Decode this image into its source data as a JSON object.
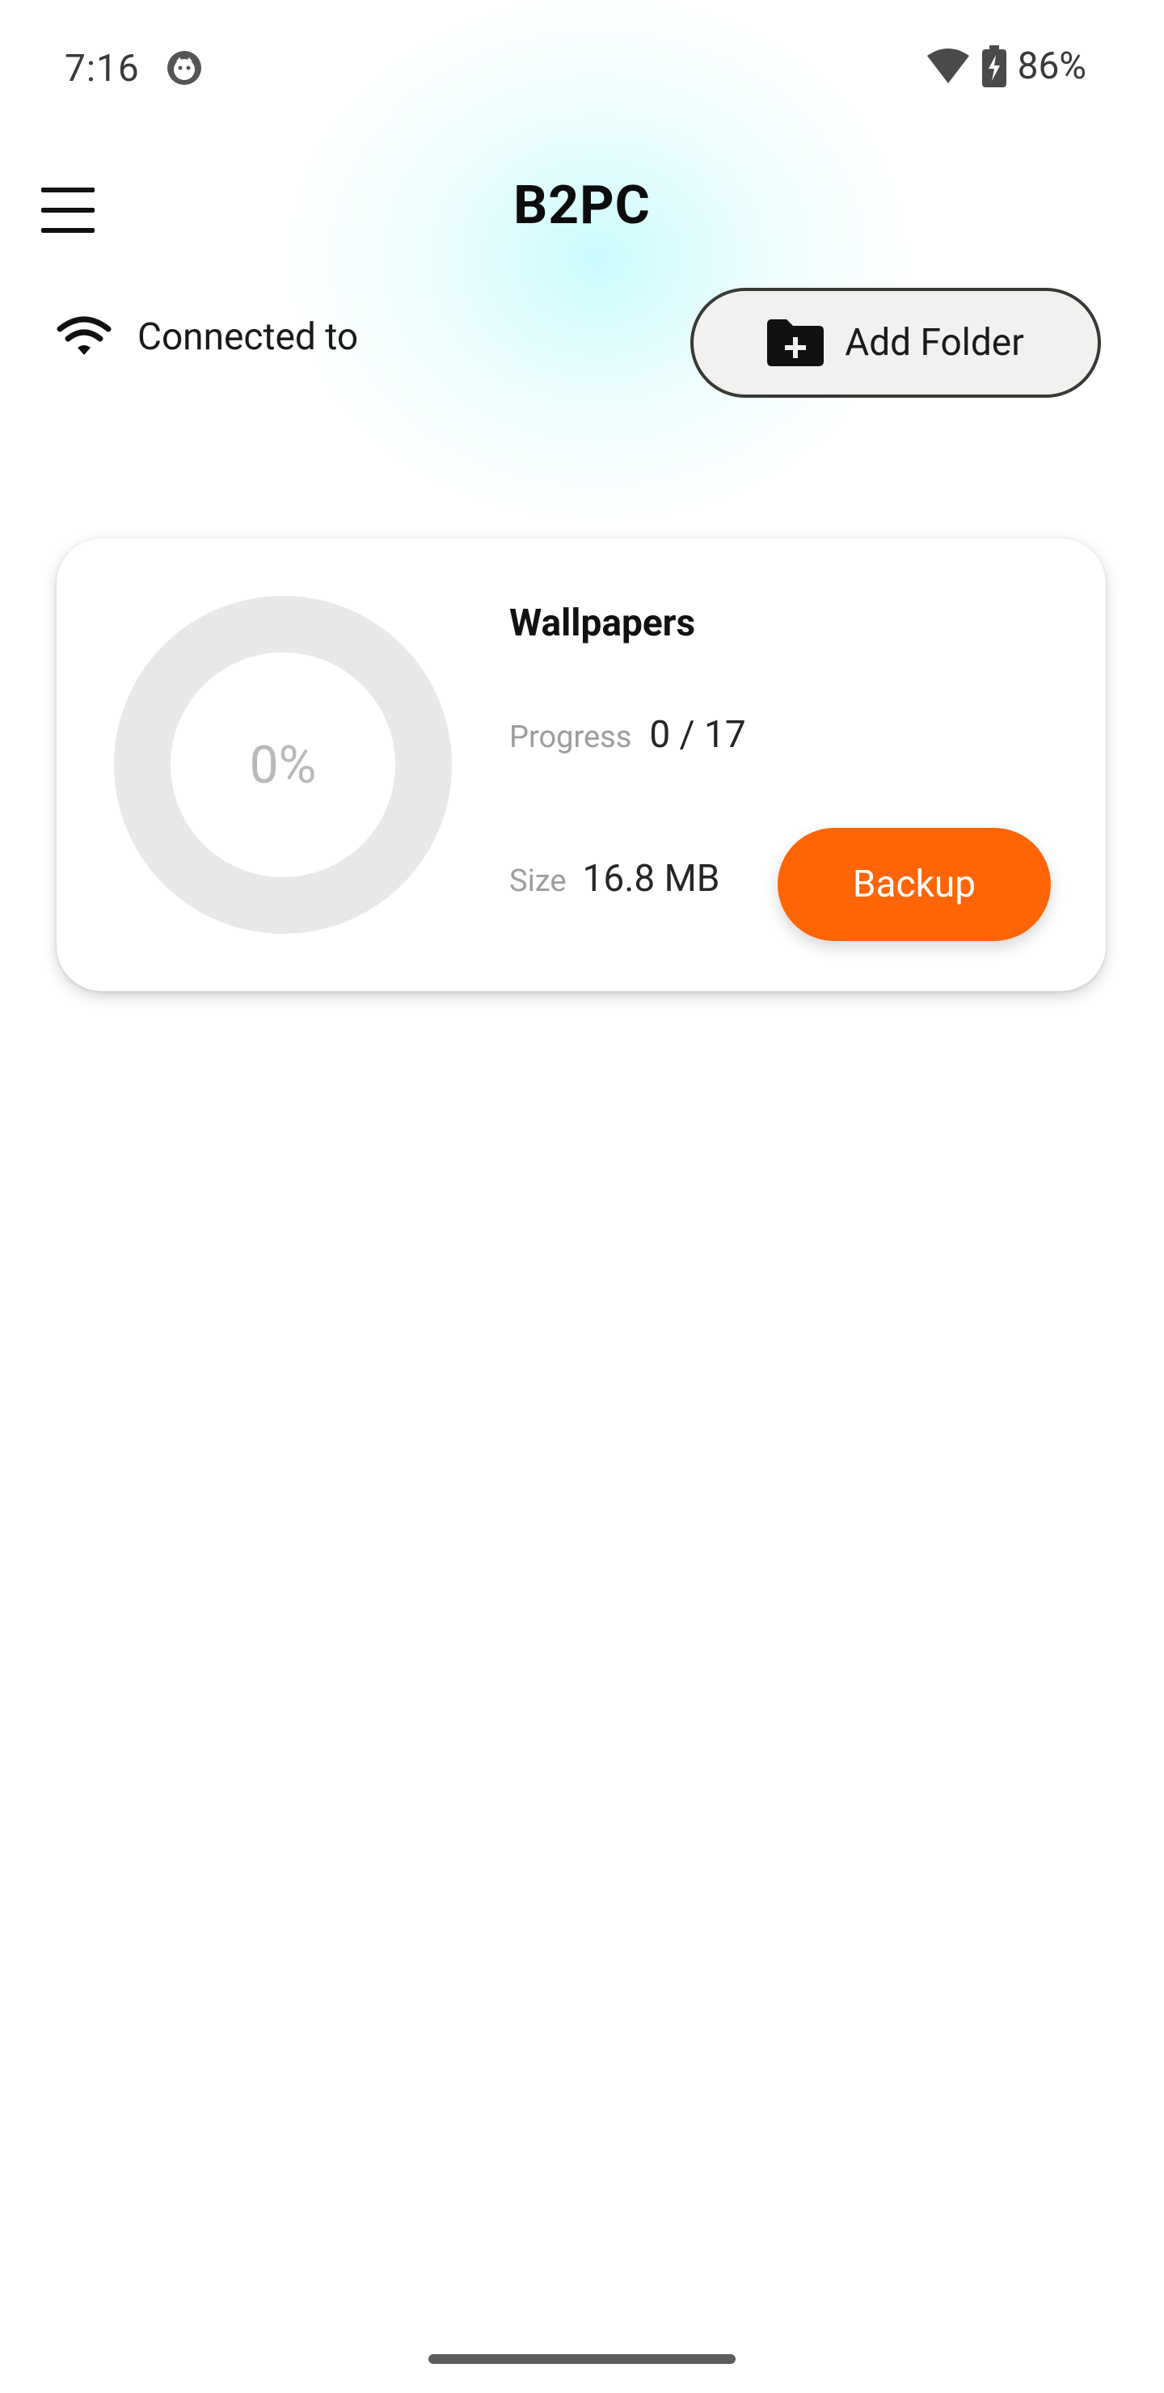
{
  "status_bar": {
    "time": "7:16",
    "battery_percent": "86%",
    "icons": [
      "face-icon",
      "wifi-signal-icon",
      "battery-charging-icon"
    ]
  },
  "app_bar": {
    "menu_icon": "hamburger-menu-icon",
    "title": "B2PC"
  },
  "connection": {
    "icon": "wifi-icon",
    "text": "Connected to"
  },
  "add_folder": {
    "icon": "folder-add-icon",
    "label": "Add Folder"
  },
  "folders": [
    {
      "name": "Wallpapers",
      "percent_text": "0%",
      "progress_fraction": 0,
      "progress_label": "Progress",
      "progress_value": "0 / 17",
      "size_label": "Size",
      "size_value": "16.8 MB",
      "backup_label": "Backup"
    }
  ],
  "colors": {
    "accent": "#ff6505",
    "ring_track": "#e8e8e8",
    "glow": "#d6fbfc"
  }
}
